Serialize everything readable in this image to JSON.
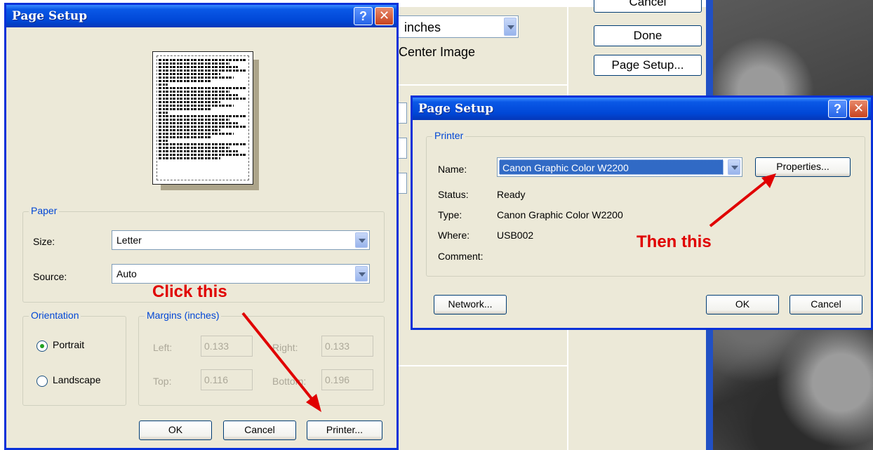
{
  "background": {
    "units_value": "inches",
    "center_image_label": "Center Image",
    "buttons": {
      "cancel": "Cancel",
      "done": "Done",
      "page_setup": "Page Setup..."
    }
  },
  "dialog_left": {
    "title": "Page Setup",
    "help_glyph": "?",
    "close_glyph": "✕",
    "paper": {
      "group_title": "Paper",
      "size_label": "Size:",
      "size_value": "Letter",
      "source_label": "Source:",
      "source_value": "Auto"
    },
    "orientation": {
      "group_title": "Orientation",
      "portrait_label": "Portrait",
      "landscape_label": "Landscape",
      "selected": "Portrait"
    },
    "margins": {
      "group_title": "Margins (inches)",
      "left_label": "Left:",
      "left_value": "0.133",
      "right_label": "Right:",
      "right_value": "0.133",
      "top_label": "Top:",
      "top_value": "0.116",
      "bottom_label": "Bottom:",
      "bottom_value": "0.196"
    },
    "buttons": {
      "ok": "OK",
      "cancel": "Cancel",
      "printer": "Printer..."
    }
  },
  "dialog_right": {
    "title": "Page Setup",
    "help_glyph": "?",
    "close_glyph": "✕",
    "printer": {
      "group_title": "Printer",
      "name_label": "Name:",
      "name_value": "Canon Graphic Color W2200",
      "status_label": "Status:",
      "status_value": "Ready",
      "type_label": "Type:",
      "type_value": "Canon Graphic Color W2200",
      "where_label": "Where:",
      "where_value": "USB002",
      "comment_label": "Comment:",
      "properties_button": "Properties..."
    },
    "buttons": {
      "network": "Network...",
      "ok": "OK",
      "cancel": "Cancel"
    }
  },
  "annotations": {
    "click_this": "Click this",
    "then_this": "Then this",
    "arrow_color": "#e00000"
  }
}
